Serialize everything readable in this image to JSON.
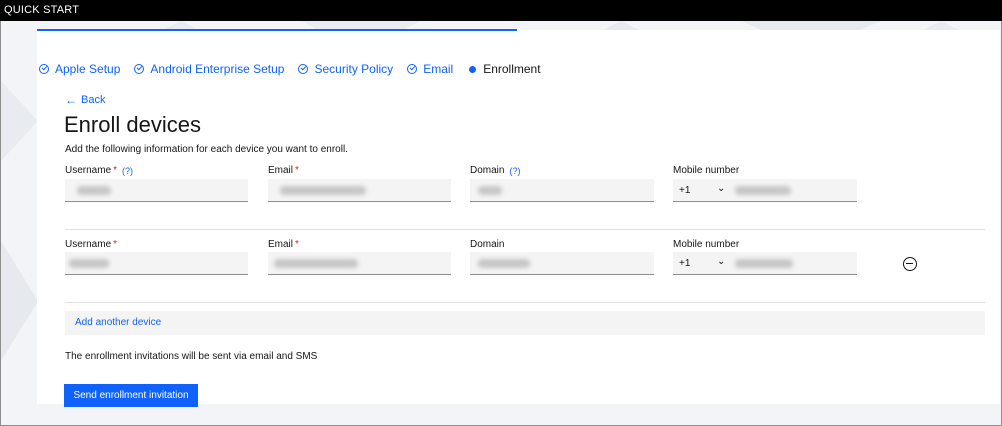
{
  "app": {
    "title": "QUICK START"
  },
  "progress": {
    "steps": [
      {
        "label": "Apple Setup",
        "state": "complete"
      },
      {
        "label": "Android Enterprise Setup",
        "state": "complete"
      },
      {
        "label": "Security Policy",
        "state": "complete"
      },
      {
        "label": "Email",
        "state": "complete"
      },
      {
        "label": "Enrollment",
        "state": "current"
      }
    ]
  },
  "nav": {
    "back_label": "Back"
  },
  "page": {
    "title": "Enroll devices",
    "subtitle": "Add the following information for each device you want to enroll."
  },
  "form": {
    "required_marker": "*",
    "help_marker": "(?)",
    "devices": [
      {
        "username_label": "Username",
        "email_label": "Email",
        "domain_label": "Domain",
        "mobile_label": "Mobile number",
        "country_code": "+1",
        "username_help": true,
        "domain_help": true,
        "removable": false
      },
      {
        "username_label": "Username",
        "email_label": "Email",
        "domain_label": "Domain",
        "mobile_label": "Mobile number",
        "country_code": "+1",
        "username_help": false,
        "domain_help": false,
        "removable": true
      }
    ],
    "add_device_label": "Add another device"
  },
  "footer": {
    "note": "The enrollment invitations will be sent via email and SMS",
    "send_label": "Send enrollment invitation"
  },
  "colors": {
    "accent": "#0f62fe",
    "required": "#da1e28",
    "topbar": "#000000"
  },
  "icons": {
    "step_complete": "checkmark-outline-icon",
    "step_current": "circle-filled-icon",
    "back": "arrow-left-icon",
    "dropdown": "chevron-down-icon",
    "remove": "subtract-alt-icon"
  }
}
